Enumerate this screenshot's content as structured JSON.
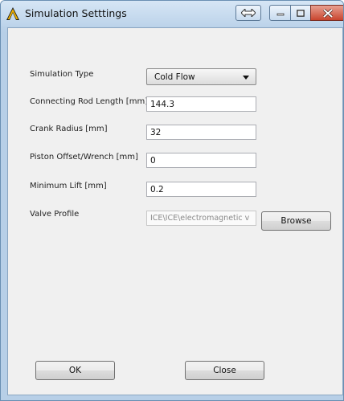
{
  "window": {
    "title": "Simulation Setttings"
  },
  "titlebar_icons": [
    "app-logo-icon",
    "resize-arrows-icon",
    "minimize-icon",
    "maximize-icon",
    "close-icon"
  ],
  "form": {
    "simulation_type": {
      "label": "Simulation Type",
      "value": "Cold Flow"
    },
    "connecting_rod_length": {
      "label": "Connecting Rod Length [mm]",
      "value": "144.3"
    },
    "crank_radius": {
      "label": "Crank Radius [mm]",
      "value": "32"
    },
    "piston_offset": {
      "label": "Piston Offset/Wrench [mm]",
      "value": "0"
    },
    "minimum_lift": {
      "label": "Minimum Lift [mm]",
      "value": "0.2"
    },
    "valve_profile": {
      "label": "Valve Profile",
      "value": "ICE\\ICE\\electromagnetic v",
      "browse_label": "Browse"
    }
  },
  "buttons": {
    "ok_label": "OK",
    "close_label": "Close"
  },
  "colors": {
    "titlebar": "#c9dcee",
    "close_button": "#c9452e",
    "client_background": "#f0f0f0"
  }
}
